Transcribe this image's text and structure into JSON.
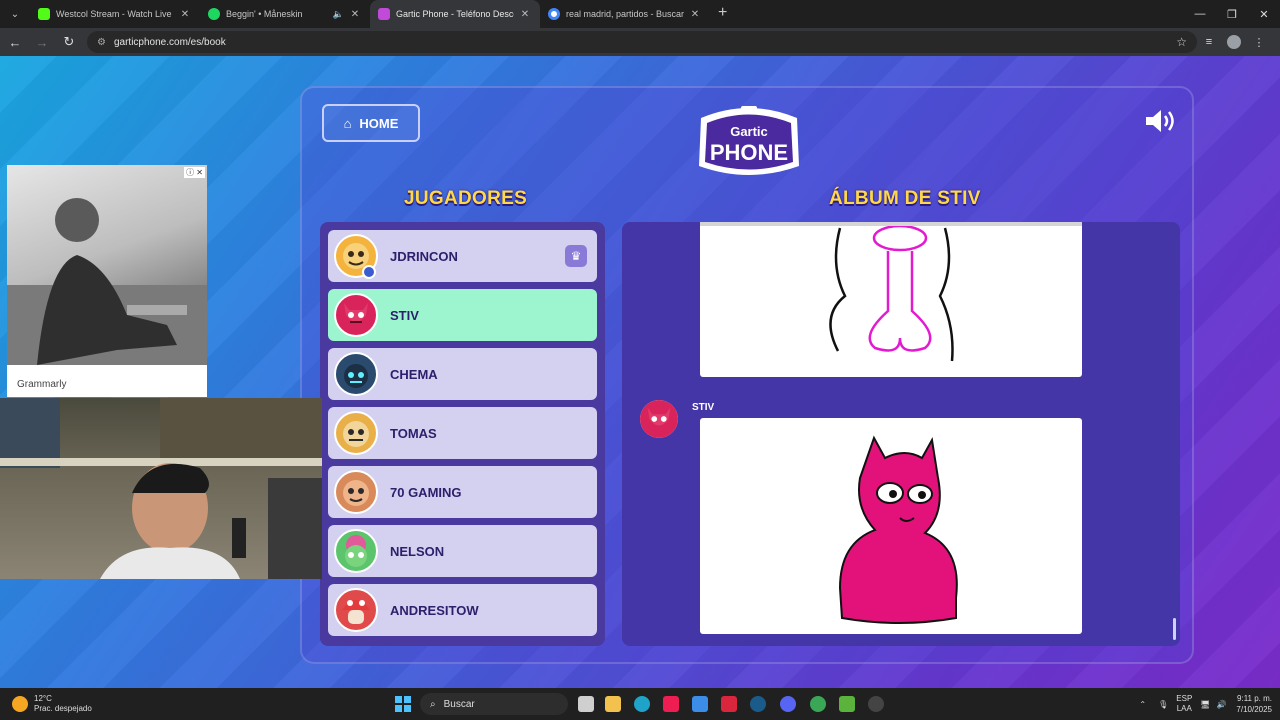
{
  "browser": {
    "tabs": [
      {
        "title": "Westcol Stream - Watch Live on",
        "color": "#53fc18",
        "active": false,
        "audio": false
      },
      {
        "title": "Beggin' • Måneskin",
        "color": "#1ed760",
        "active": false,
        "audio": true
      },
      {
        "title": "Gartic Phone - Teléfono Descom",
        "color": "#c14bd8",
        "active": true,
        "audio": false
      },
      {
        "title": "real madrid, partidos - Buscar co",
        "color": "#4285f4",
        "active": false,
        "audio": false
      }
    ],
    "url": "garticphone.com/es/book"
  },
  "game": {
    "home_label": "HOME",
    "logo_top": "Gartic",
    "logo_bottom": "PHONE",
    "players_heading": "JUGADORES",
    "album_heading": "ÁLBUM DE STIV",
    "players": [
      {
        "name": "JDRINCON",
        "host": true,
        "active": false,
        "color": "#f4b33d"
      },
      {
        "name": "STIV",
        "host": false,
        "active": true,
        "color": "#d8245a"
      },
      {
        "name": "CHEMA",
        "host": false,
        "active": false,
        "color": "#2a4b6e"
      },
      {
        "name": "TOMAS",
        "host": false,
        "active": false,
        "color": "#e9b04a"
      },
      {
        "name": "70 GAMING",
        "host": false,
        "active": false,
        "color": "#d88a5a"
      },
      {
        "name": "NELSON",
        "host": false,
        "active": false,
        "color": "#5bc46d"
      },
      {
        "name": "ANDRESITOW",
        "host": false,
        "active": false,
        "color": "#e04a4a"
      }
    ],
    "album_entry_author": "STIV"
  },
  "ad": {
    "label": "Grammarly"
  },
  "taskbar": {
    "temperature": "12°C",
    "weather": "Prac. despejado",
    "search_placeholder": "Buscar",
    "lang_top": "ESP",
    "lang_bottom": "LAA",
    "time": "9:11 p. m.",
    "date": "7/10/2025"
  }
}
